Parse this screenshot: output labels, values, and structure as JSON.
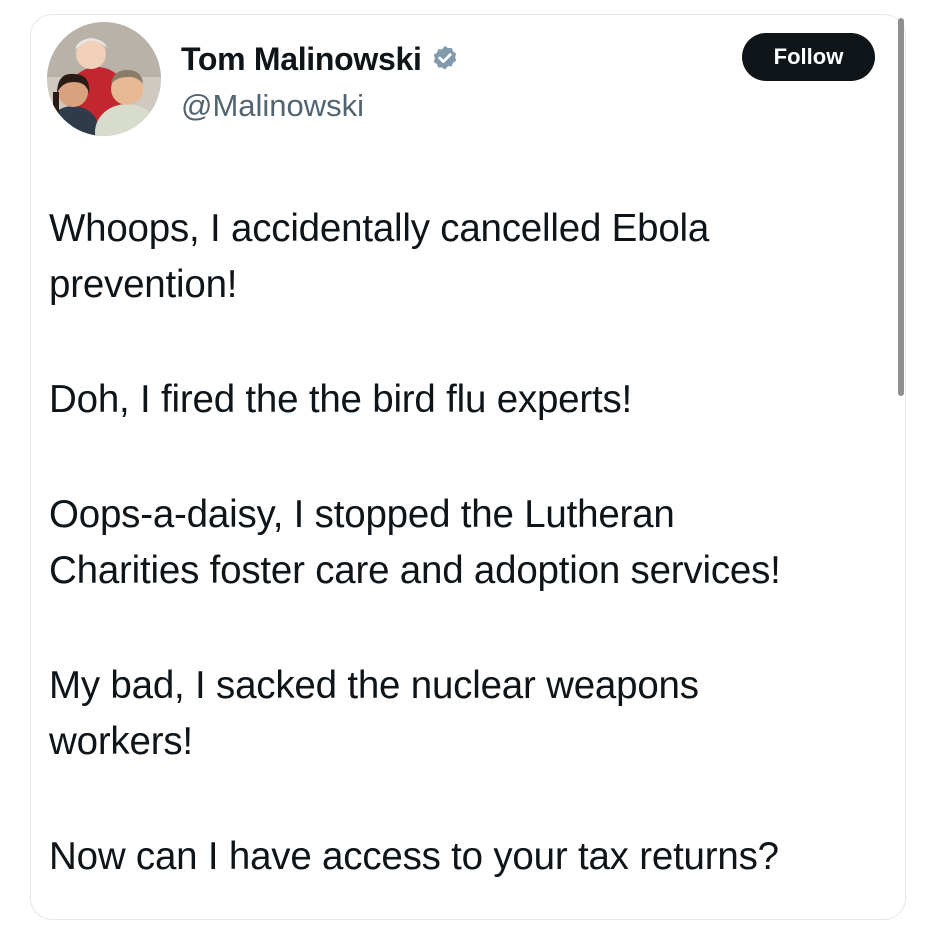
{
  "author": {
    "display_name": "Tom Malinowski",
    "handle": "@Malinowski",
    "verified": true
  },
  "actions": {
    "follow_label": "Follow"
  },
  "tweet": {
    "paragraphs": [
      "Whoops, I accidentally cancelled Ebola\nprevention!",
      "Doh, I fired the the bird flu experts!",
      "Oops-a-daisy, I stopped the Lutheran\nCharities foster care and adoption services!",
      "My bad, I sacked the nuclear weapons\nworkers!",
      "Now can I have access to your tax returns?"
    ]
  },
  "icons": {
    "verified": "verified-badge-icon",
    "avatar": "profile-photo"
  },
  "colors": {
    "text": "#0f1419",
    "secondary_text": "#536471",
    "verified_badge": "#829aab",
    "follow_button_bg": "#0f1419",
    "follow_button_text": "#ffffff"
  }
}
